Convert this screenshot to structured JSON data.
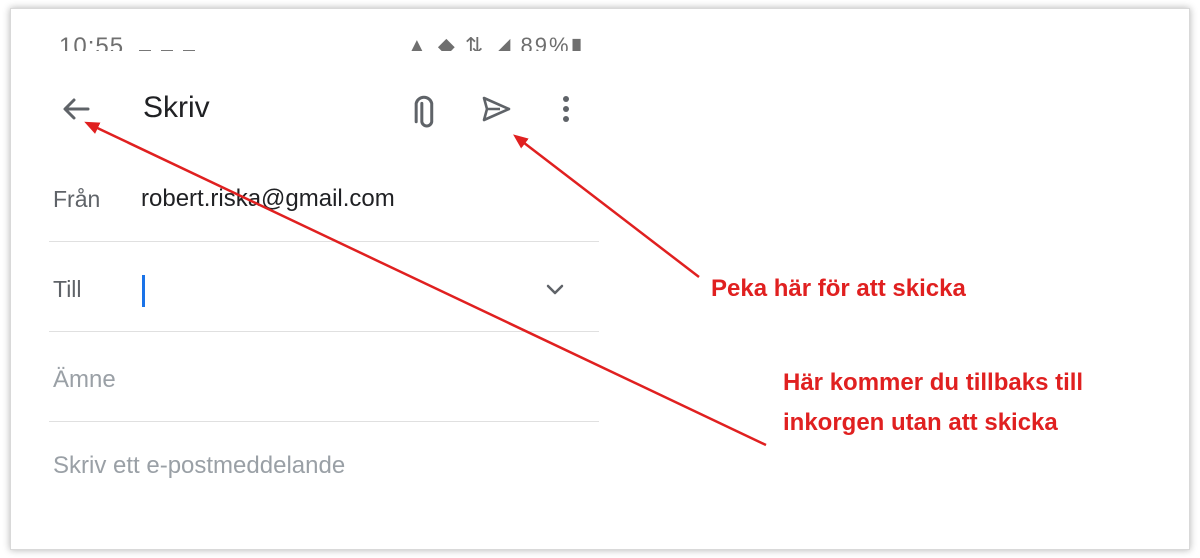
{
  "statusbar": {
    "time": "10:55",
    "right_icons": "▲ ◆ ⇅ ◢ 89%▮"
  },
  "toolbar": {
    "title": "Skriv",
    "icons": [
      "back-arrow-icon",
      "paperclip-icon",
      "send-icon",
      "more-vert-icon"
    ]
  },
  "compose": {
    "from_label": "Från",
    "from_value": "robert.riska@gmail.com",
    "to_label": "Till",
    "subject_placeholder": "Ämne",
    "body_placeholder": "Skriv ett e-postmeddelande"
  },
  "annotations": {
    "send_hint": "Peka här för att skicka",
    "back_hint_line1": "Här kommer du tillbaks till",
    "back_hint_line2": "inkorgen utan att skicka"
  },
  "colors": {
    "annotation": "#e02020",
    "cursor": "#1a73e8"
  }
}
